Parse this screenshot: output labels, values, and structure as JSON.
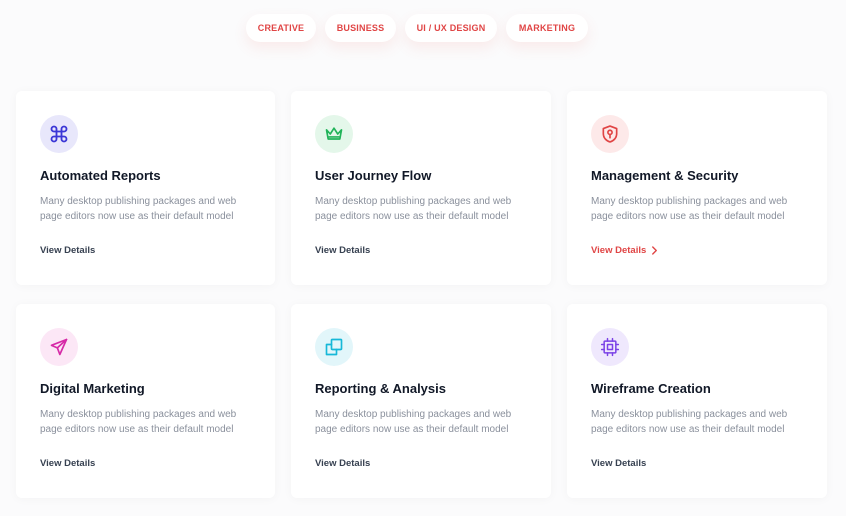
{
  "tabs": [
    {
      "label": "CREATIVE"
    },
    {
      "label": "BUSINESS"
    },
    {
      "label": "UI / UX DESIGN"
    },
    {
      "label": "MARKETING"
    }
  ],
  "colors": {
    "accent": "#e04545",
    "title": "#111827",
    "body": "#8a909c",
    "link": "#374151"
  },
  "cards": [
    {
      "title": "Automated Reports",
      "description": "Many desktop publishing packages and web page editors now use as their default model",
      "link_label": "View Details",
      "icon": "command-icon",
      "icon_bg": "#e8e7fb",
      "icon_color": "#3b37d6"
    },
    {
      "title": "User Journey Flow",
      "description": "Many desktop publishing packages and web page editors now use as their default model",
      "link_label": "View Details",
      "icon": "crown-icon",
      "icon_bg": "#e4f7ea",
      "icon_color": "#22b45a"
    },
    {
      "title": "Management & Security",
      "description": "Many desktop publishing packages and web page editors now use as their default model",
      "link_label": "View Details",
      "icon": "shield-lock-icon",
      "icon_bg": "#fde9e9",
      "icon_color": "#e04545",
      "active": true
    },
    {
      "title": "Digital Marketing",
      "description": "Many desktop publishing packages and web page editors now use as their default model",
      "link_label": "View Details",
      "icon": "send-icon",
      "icon_bg": "#fce7f6",
      "icon_color": "#d62aa7"
    },
    {
      "title": "Reporting & Analysis",
      "description": "Many desktop publishing packages and web page editors now use as their default model",
      "link_label": "View Details",
      "icon": "copy-icon",
      "icon_bg": "#e2f6fa",
      "icon_color": "#16b8d8"
    },
    {
      "title": "Wireframe Creation",
      "description": "Many desktop publishing packages and web page editors now use as their default model",
      "link_label": "View Details",
      "icon": "cpu-icon",
      "icon_bg": "#efe8fd",
      "icon_color": "#7b42e6"
    }
  ]
}
